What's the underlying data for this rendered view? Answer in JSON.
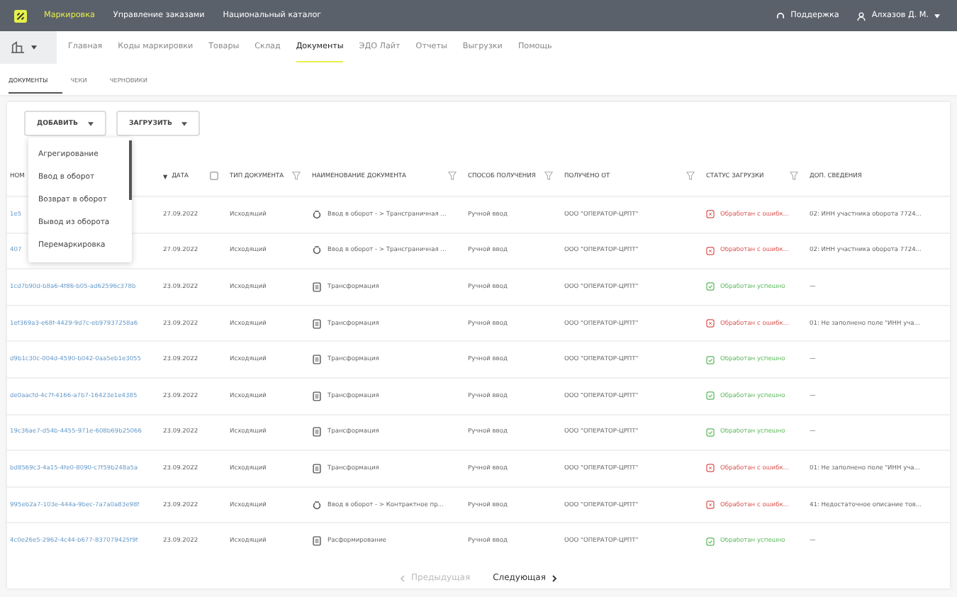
{
  "top_bar": {
    "sections": [
      {
        "label": "Маркировка",
        "selected": true
      },
      {
        "label": "Управление заказами",
        "selected": false
      },
      {
        "label": "Национальный каталог",
        "selected": false
      }
    ],
    "support": "Поддержка",
    "user": "Алхазов Д. М."
  },
  "main_nav": [
    {
      "label": "Главная",
      "selected": false
    },
    {
      "label": "Коды маркировки",
      "selected": false
    },
    {
      "label": "Товары",
      "selected": false
    },
    {
      "label": "Склад",
      "selected": false
    },
    {
      "label": "Документы",
      "selected": true
    },
    {
      "label": "ЭДО Лайт",
      "selected": false
    },
    {
      "label": "Отчеты",
      "selected": false
    },
    {
      "label": "Выгрузки",
      "selected": false
    },
    {
      "label": "Помощь",
      "selected": false
    }
  ],
  "sub_tabs": [
    {
      "label": "ДОКУМЕНТЫ",
      "selected": true
    },
    {
      "label": "ЧЕКИ",
      "selected": false
    },
    {
      "label": "ЧЕРНОВИКИ",
      "selected": false
    }
  ],
  "buttons": [
    "ДОБАВИТЬ",
    "ЗАГРУЗИТЬ"
  ],
  "dropdown": [
    "Агрегирование",
    "Ввод в оборот",
    "Возврат в оборот",
    "Вывод из оборота",
    "Перемаркировка"
  ],
  "table": {
    "columns": [
      {
        "label": "НОМ",
        "filter": false
      },
      {
        "label": "ДАТА",
        "sort": "▼",
        "filter": false
      },
      {
        "label": "ТИП ДОКУМЕНТА",
        "filter": true
      },
      {
        "label": "НАИМЕНОВАНИЕ ДОКУМЕНТА",
        "filter": true
      },
      {
        "label": "СПОСОБ ПОЛУЧЕНИЯ",
        "filter": true
      },
      {
        "label": "ПОЛУЧЕНО ОТ",
        "filter": true
      },
      {
        "label": "СТАТУС ЗАГРУЗКИ",
        "filter": true
      },
      {
        "label": "ДОП. СВЕДЕНИЯ",
        "filter": false
      }
    ],
    "rows": [
      {
        "number": "1e5",
        "date": "27.09.2022",
        "type": "Исходящий",
        "name": {
          "kind": "entry",
          "text": "Ввод в оборот - > Трансграничная ..."
        },
        "method": "Ручной ввод",
        "from": "ООО \"ОПЕРАТОР-ЦРПТ\"",
        "status": {
          "kind": "error",
          "text": "Обработан с ошибк..."
        },
        "info": "02: ИНН участника оборота 7724..."
      },
      {
        "number": "407",
        "date": "27.09.2022",
        "type": "Исходящий",
        "name": {
          "kind": "entry",
          "text": "Ввод в оборот - > Трансграничная ..."
        },
        "method": "Ручной ввод",
        "from": "ООО \"ОПЕРАТОР-ЦРПТ\"",
        "status": {
          "kind": "error",
          "text": "Обработан с ошибк..."
        },
        "info": "02: ИНН участника оборота 7724..."
      },
      {
        "number": "1cd7b90d-b8a6-4f86-b05-ad62596c378b",
        "date": "23.09.2022",
        "type": "Исходящий",
        "name": {
          "kind": "doc",
          "text": "Трансформация"
        },
        "method": "Ручной ввод",
        "from": "ООО \"ОПЕРАТОР-ЦРПТ\"",
        "status": {
          "kind": "ok",
          "text": "Обработан успешно"
        },
        "info": "—"
      },
      {
        "number": "1ef369a3-e68f-4429-9d7c-eb97937258a6",
        "date": "23.09.2022",
        "type": "Исходящий",
        "name": {
          "kind": "doc",
          "text": "Трансформация"
        },
        "method": "Ручной ввод",
        "from": "ООО \"ОПЕРАТОР-ЦРПТ\"",
        "status": {
          "kind": "error",
          "text": "Обработан с ошибк..."
        },
        "info": "01: Не заполнено поле \"ИНН уча..."
      },
      {
        "number": "d9b1c30c-004d-4590-b042-0aa5eb1e3055",
        "date": "23.09.2022",
        "type": "Исходящий",
        "name": {
          "kind": "doc",
          "text": "Трансформация"
        },
        "method": "Ручной ввод",
        "from": "ООО \"ОПЕРАТОР-ЦРПТ\"",
        "status": {
          "kind": "ok",
          "text": "Обработан успешно"
        },
        "info": "—"
      },
      {
        "number": "de0aacfd-4c7f-4166-a7b7-16423e1e4385",
        "date": "23.09.2022",
        "type": "Исходящий",
        "name": {
          "kind": "doc",
          "text": "Трансформация"
        },
        "method": "Ручной ввод",
        "from": "ООО \"ОПЕРАТОР-ЦРПТ\"",
        "status": {
          "kind": "ok",
          "text": "Обработан успешно"
        },
        "info": "—"
      },
      {
        "number": "19c36ae7-d54b-4455-971e-608b69b25066",
        "date": "23.09.2022",
        "type": "Исходящий",
        "name": {
          "kind": "doc",
          "text": "Трансформация"
        },
        "method": "Ручной ввод",
        "from": "ООО \"ОПЕРАТОР-ЦРПТ\"",
        "status": {
          "kind": "ok",
          "text": "Обработан успешно"
        },
        "info": "—"
      },
      {
        "number": "bd8569c3-4a15-4fe0-8090-c7f59b248a5a",
        "date": "23.09.2022",
        "type": "Исходящий",
        "name": {
          "kind": "doc",
          "text": "Трансформация"
        },
        "method": "Ручной ввод",
        "from": "ООО \"ОПЕРАТОР-ЦРПТ\"",
        "status": {
          "kind": "error",
          "text": "Обработан с ошибк..."
        },
        "info": "01: Не заполнено поле \"ИНН уча..."
      },
      {
        "number": "995eb2a7-103e-444a-9bec-7a7a0a83e98f",
        "date": "23.09.2022",
        "type": "Исходящий",
        "name": {
          "kind": "entry",
          "text": "Ввод в оборот - > Контрактное пр..."
        },
        "method": "Ручной ввод",
        "from": "ООО \"ОПЕРАТОР-ЦРПТ\"",
        "status": {
          "kind": "error",
          "text": "Обработан с ошибк..."
        },
        "info": "41: Недостаточное описание тов..."
      },
      {
        "number": "4c0e26e5-2962-4c44-b677-837079425f9f",
        "date": "23.09.2022",
        "type": "Исходящий",
        "name": {
          "kind": "doc",
          "text": "Расформирование"
        },
        "method": "Ручной ввод",
        "from": "ООО \"ОПЕРАТОР-ЦРПТ\"",
        "status": {
          "kind": "ok",
          "text": "Обработан успешно"
        },
        "info": "—"
      }
    ]
  },
  "pagination": {
    "prev": {
      "label": "Предыдущая",
      "disabled": true
    },
    "next": {
      "label": "Следующая",
      "disabled": false
    }
  }
}
